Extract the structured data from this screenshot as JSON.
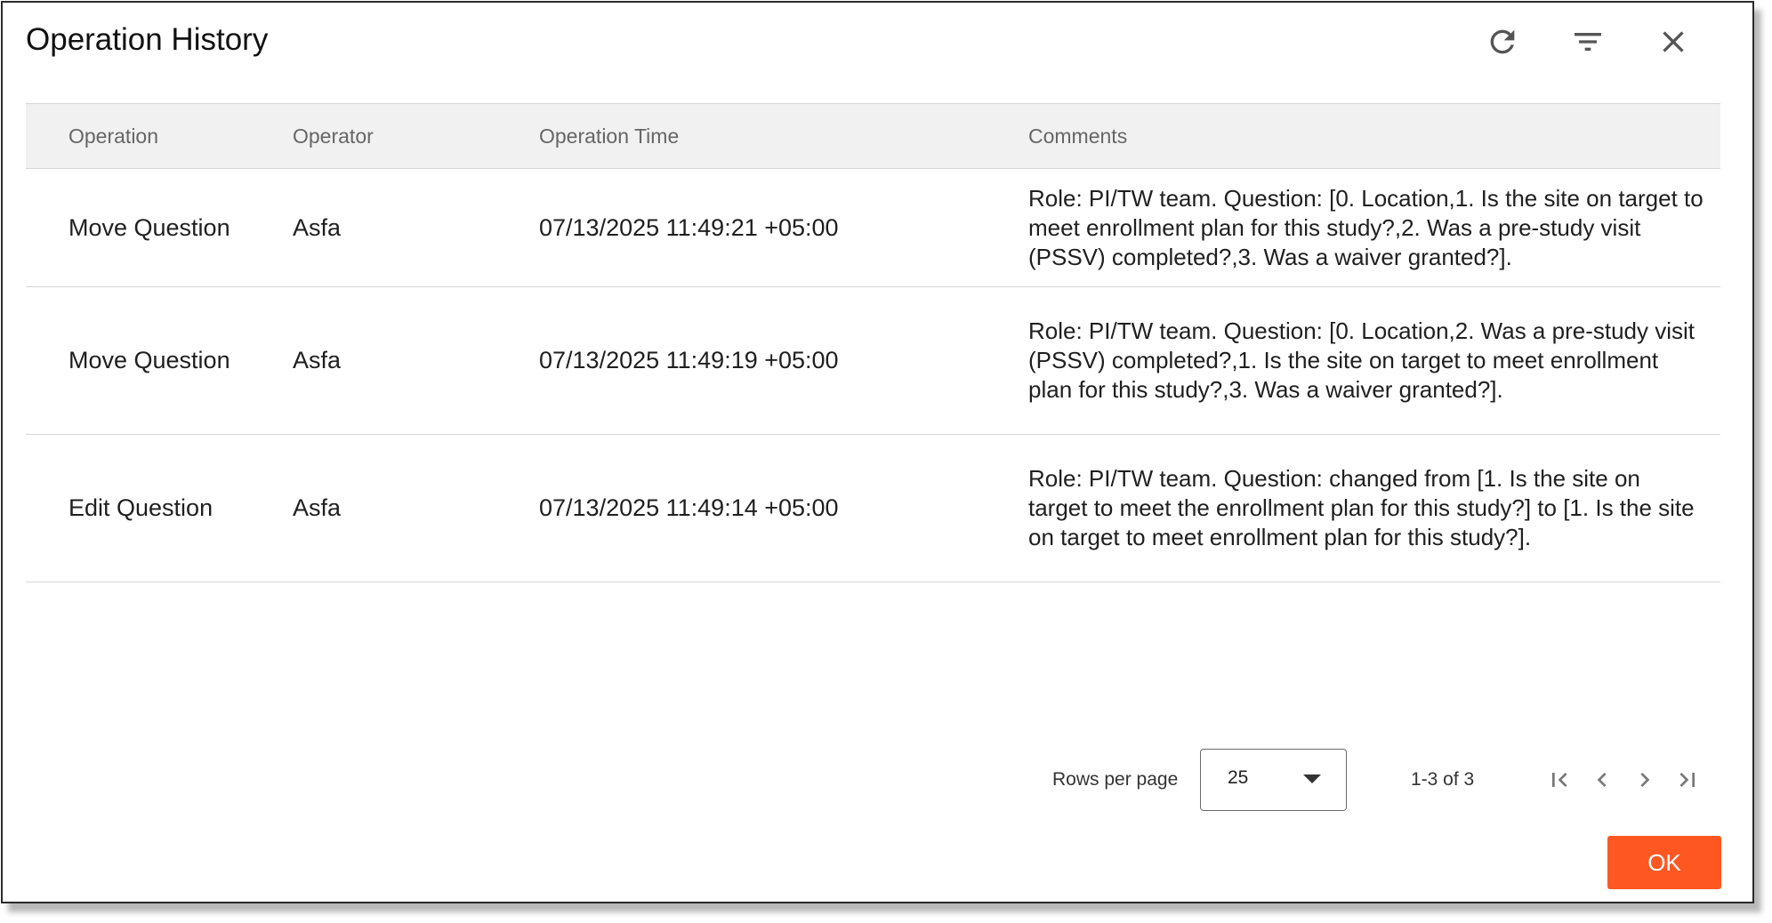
{
  "dialog": {
    "title": "Operation History",
    "toolbar": {
      "refresh_icon": "refresh-icon",
      "filter_icon": "filter-icon",
      "close_icon": "close-icon"
    }
  },
  "table": {
    "columns": [
      "Operation",
      "Operator",
      "Operation Time",
      "Comments"
    ],
    "rows": [
      {
        "operation": "Move Question",
        "operator": "Asfa",
        "time": "07/13/2025 11:49:21 +05:00",
        "comments": "Role: PI/TW team. Question: [0. Location,1. Is the site on target to meet enrollment plan for this study?,2. Was a pre-study visit (PSSV) completed?,3. Was a waiver granted?]."
      },
      {
        "operation": "Move Question",
        "operator": "Asfa",
        "time": "07/13/2025 11:49:19 +05:00",
        "comments": "Role: PI/TW team. Question: [0. Location,2. Was a pre-study visit (PSSV) completed?,1. Is the site on target to meet enrollment plan for this study?,3. Was a waiver granted?]."
      },
      {
        "operation": "Edit Question",
        "operator": "Asfa",
        "time": "07/13/2025 11:49:14 +05:00",
        "comments": "Role: PI/TW team. Question: changed from [1. Is the site on target to meet the enrollment plan for this study?] to [1. Is the site on target to meet enrollment plan for this study?]."
      }
    ]
  },
  "pagination": {
    "rows_per_page_label": "Rows per page",
    "rows_per_page_value": "25",
    "range_text": "1-3 of 3",
    "icons": [
      "first-page-icon",
      "previous-page-icon",
      "next-page-icon",
      "last-page-icon"
    ]
  },
  "actions": {
    "ok_label": "OK",
    "ok_color": "#ff5722"
  }
}
